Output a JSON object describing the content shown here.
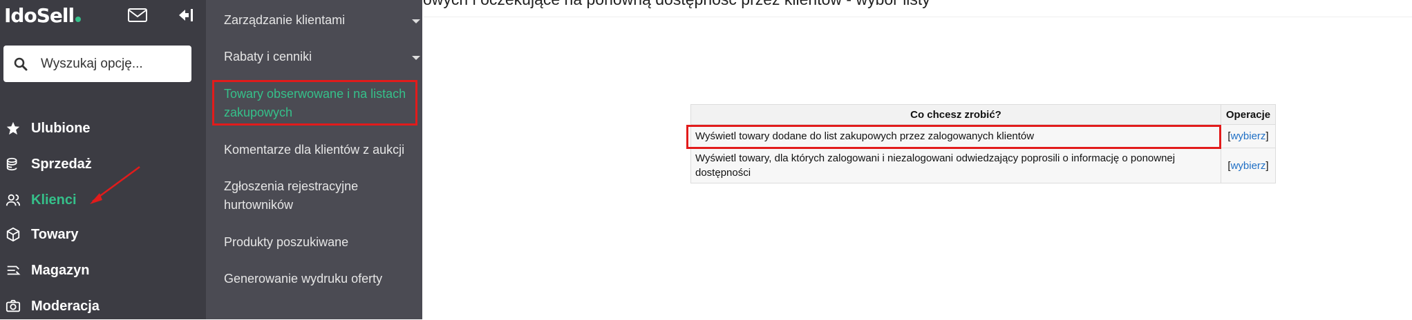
{
  "brand": {
    "logo_text": "IdoSell"
  },
  "search": {
    "placeholder": "Wyszukaj opcję..."
  },
  "nav": [
    {
      "label": "Ulubione",
      "icon": "star-icon"
    },
    {
      "label": "Sprzedaż",
      "icon": "coins-icon"
    },
    {
      "label": "Klienci",
      "icon": "users-icon",
      "active": true
    },
    {
      "label": "Towary",
      "icon": "box-icon"
    },
    {
      "label": "Magazyn",
      "icon": "warehouse-icon"
    },
    {
      "label": "Moderacja",
      "icon": "camera-icon"
    }
  ],
  "submenu": [
    {
      "label": "Zarządzanie klientami",
      "has_children": true
    },
    {
      "label": "Rabaty i cenniki",
      "has_children": true
    },
    {
      "label": "Towary obserwowane i na listach zakupowych",
      "active": true
    },
    {
      "label": "Komentarze dla klientów z aukcji"
    },
    {
      "label": "Zgłoszenia rejestracyjne hurtowników"
    },
    {
      "label": "Produkty poszukiwane"
    },
    {
      "label": "Generowanie wydruku oferty"
    }
  ],
  "page": {
    "title": "owych i oczekujące na ponowną dostępność przez klientów - wybór listy"
  },
  "table": {
    "headers": [
      "Co chcesz zrobić?",
      "Operacje"
    ],
    "rows": [
      {
        "description": "Wyświetl towary dodane do list zakupowych przez zalogowanych klientów",
        "link": "wybierz"
      },
      {
        "description": "Wyświetl towary, dla których zalogowani i niezalogowani odwiedzający poprosili o informację o ponownej dostępności",
        "link": "wybierz"
      }
    ]
  },
  "colors": {
    "sidebar": "#3c3c43",
    "submenu": "#4b4b53",
    "accent": "#35c08a",
    "highlight": "#e21b1b",
    "link": "#1f6fc5"
  }
}
